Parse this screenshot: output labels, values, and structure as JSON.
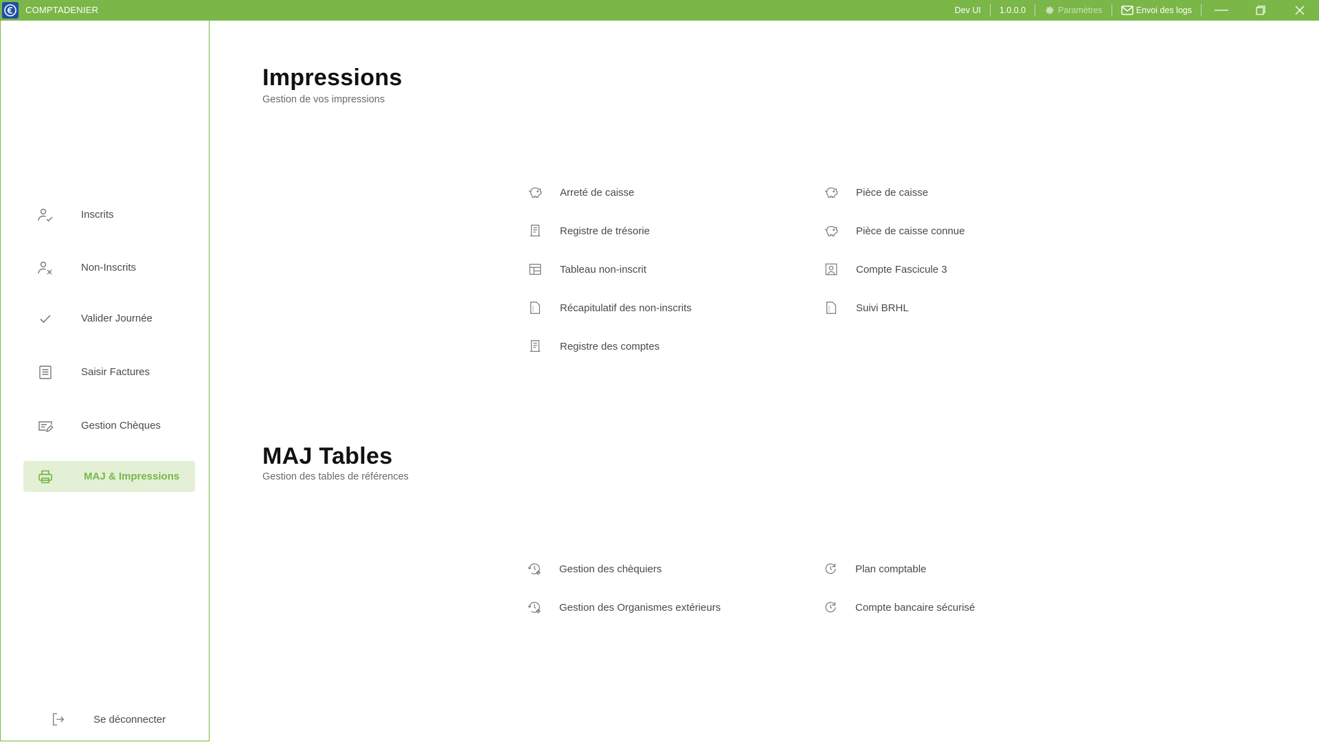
{
  "app": {
    "title": "COMPTADENIER"
  },
  "titlebar": {
    "env": "Dev UI",
    "version": "1.0.0.0",
    "settings": "Paramètres",
    "send_logs": "Envoi des logs"
  },
  "sidebar": {
    "items": [
      {
        "label": "Inscrits",
        "icon": "user-check-icon"
      },
      {
        "label": "Non-Inscrits",
        "icon": "user-x-icon"
      },
      {
        "label": "Valider Journée",
        "icon": "check-icon"
      },
      {
        "label": "Saisir Factures",
        "icon": "document-lines-icon"
      },
      {
        "label": "Gestion Chèques",
        "icon": "cheque-edit-icon"
      },
      {
        "label": "MAJ & Impressions",
        "icon": "printer-icon",
        "active": true
      }
    ],
    "logout": "Se déconnecter"
  },
  "impressions": {
    "title": "Impressions",
    "subtitle": "Gestion de vos impressions",
    "links": [
      {
        "label": "Arreté de caisse",
        "icon": "piggy-bank-icon"
      },
      {
        "label": "Pièce de caisse",
        "icon": "piggy-bank-icon"
      },
      {
        "label": "Registre de trésorie",
        "icon": "register-icon"
      },
      {
        "label": "Pièce de caisse connue",
        "icon": "piggy-bank-icon"
      },
      {
        "label": "Tableau non-inscrit",
        "icon": "table-icon"
      },
      {
        "label": "Compte Fascicule 3",
        "icon": "account-box-icon"
      },
      {
        "label": "Récapitulatif des non-inscrits",
        "icon": "file-list-icon"
      },
      {
        "label": "Suivi BRHL",
        "icon": "file-list-icon"
      },
      {
        "label": "Registre des comptes",
        "icon": "register-icon"
      }
    ]
  },
  "maj_tables": {
    "title": "MAJ Tables",
    "subtitle": "Gestion des tables de références",
    "links": [
      {
        "label": "Gestion des chèquiers",
        "icon": "history-gear-icon"
      },
      {
        "label": "Plan comptable",
        "icon": "refresh-icon"
      },
      {
        "label": "Gestion des Organismes extérieurs",
        "icon": "history-gear-icon"
      },
      {
        "label": "Compte bancaire sécurisé",
        "icon": "refresh-icon"
      }
    ]
  },
  "colors": {
    "accent": "#7ab648",
    "active_bg": "#e3f0d6",
    "logo_bg": "#1f4fa8"
  }
}
